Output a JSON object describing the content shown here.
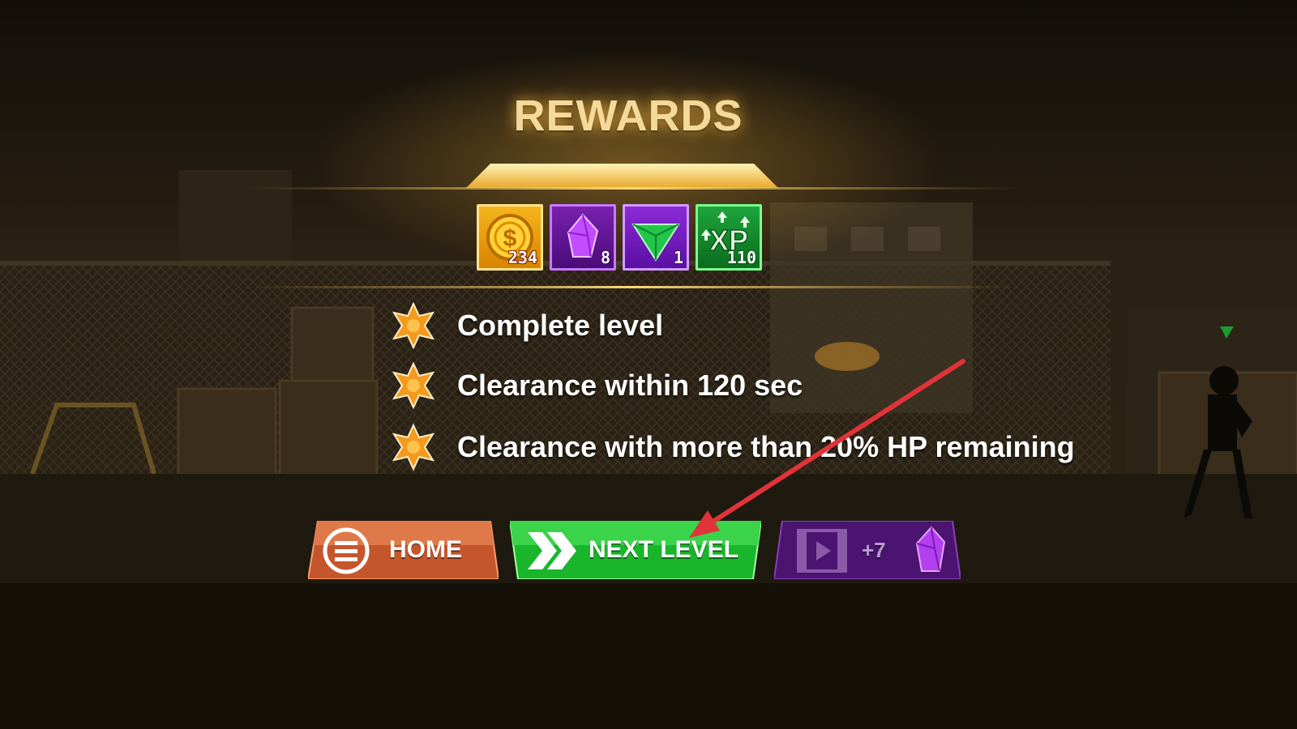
{
  "title": "REWARDS",
  "rewards": [
    {
      "icon": "coin-icon",
      "count": "234"
    },
    {
      "icon": "purple-crystal-icon",
      "count": "8"
    },
    {
      "icon": "green-gem-icon",
      "count": "1"
    },
    {
      "icon": "xp-icon",
      "count": "110"
    }
  ],
  "objectives": [
    {
      "text": "Complete level"
    },
    {
      "text": "Clearance within 120 sec"
    },
    {
      "text": "Clearance with more than 20% HP remaining"
    }
  ],
  "buttons": {
    "home": "HOME",
    "next_level": "NEXT LEVEL",
    "video_reward": "+7"
  },
  "colors": {
    "title": "#f4d99a",
    "home_button": "#c5562c",
    "next_button": "#19b62c",
    "video_button": "#4b1470",
    "star": "#f39a1f",
    "annotation_arrow": "#e0333a"
  }
}
